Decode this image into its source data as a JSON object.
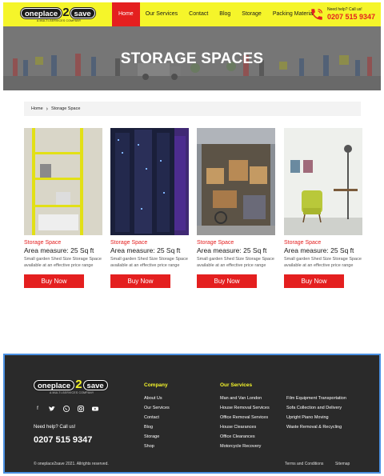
{
  "header": {
    "logo": {
      "word1": "oneplace",
      "digit": "2",
      "word2": "save",
      "tagline": "A MULTI-SERVICES COMPANY"
    },
    "nav": [
      "Home",
      "Our Services",
      "Contact",
      "Blog",
      "Storage",
      "Packing Material"
    ],
    "active_nav": "Home",
    "call": {
      "label": "Need help? Call us!",
      "number": "0207 515 9347"
    },
    "colors": {
      "bar": "#f5f52a",
      "accent": "#e41f1f"
    }
  },
  "hero": {
    "title": "STORAGE SPACES"
  },
  "breadcrumb": {
    "home": "Home",
    "current": "Storage Space"
  },
  "cards": [
    {
      "category": "Storage Space",
      "title": "Area measure: 25 Sq ft",
      "description": "Small garden Shed Size Storage Space available at an effective price range",
      "button": "Buy Now",
      "image": "yellow-shelf"
    },
    {
      "category": "Storage Space",
      "title": "Area measure: 25 Sq ft",
      "description": "Small garden Shed Size Storage Space available at an effective price range",
      "button": "Buy Now",
      "image": "server-room"
    },
    {
      "category": "Storage Space",
      "title": "Area measure: 25 Sq ft",
      "description": "Small garden Shed Size Storage Space available at an effective price range",
      "button": "Buy Now",
      "image": "storage-unit"
    },
    {
      "category": "Storage Space",
      "title": "Area measure: 25 Sq ft",
      "description": "Small garden Shed Size Storage Space available at an effective price range",
      "button": "Buy Now",
      "image": "room-chair"
    }
  ],
  "footer": {
    "logo": {
      "word1": "oneplace",
      "digit": "2",
      "word2": "save",
      "tagline": "A MULTI-SERVICES COMPANY"
    },
    "socials": [
      "facebook-icon",
      "twitter-icon",
      "whatsapp-icon",
      "instagram-icon",
      "youtube-icon"
    ],
    "need_help": "Need help? Call us!",
    "number": "0207 515 9347",
    "company_heading": "Company",
    "company_links": [
      "About Us",
      "Our Services",
      "Contact",
      "Blog",
      "Storage",
      "Shop"
    ],
    "services_heading": "Our Services",
    "services_col1": [
      "Man and Van London",
      "House Removal Services",
      "Office Removal Services",
      "House Clearances",
      "Office Clearances",
      "Motorcycle Recovery"
    ],
    "services_col2": [
      "Film Equipment Transportation",
      "Sofa Collection and Delivery",
      "Upright Piano Moving",
      "Waste Removal & Recycling"
    ],
    "copyright": "© oneplace2save 2021. Allrights reserved.",
    "terms": "Terms and Conditions",
    "sitemap": "Sitemap"
  }
}
